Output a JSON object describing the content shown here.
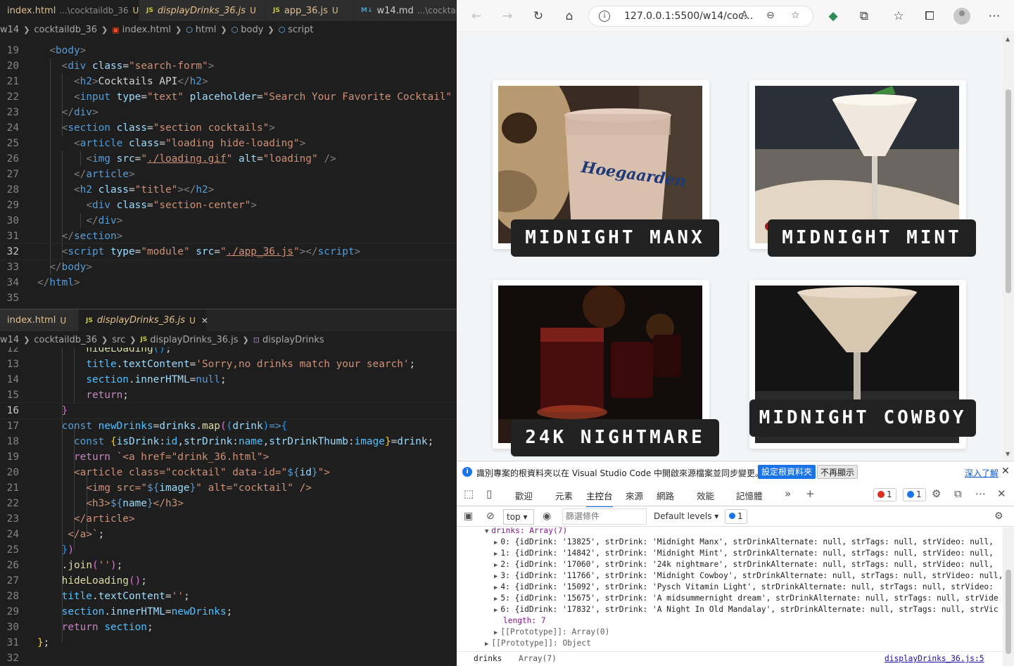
{
  "editor_top": {
    "tabs": [
      {
        "name": "index.html",
        "path": "...\\cocktaildb_36",
        "status": "U",
        "icon": "html-file-icon",
        "active": true
      },
      {
        "name": "displayDrinks_36.js",
        "path": "",
        "status": "U",
        "icon": "js-file-icon",
        "active": false
      },
      {
        "name": "app_36.js",
        "path": "",
        "status": "U",
        "icon": "js-file-icon",
        "active": false
      },
      {
        "name": "w14.md",
        "path": "...\\cocktailc",
        "status": "",
        "icon": "markdown-file-icon",
        "active": false
      }
    ],
    "breadcrumb": [
      "w14",
      "cocktaildb_36",
      "index.html",
      "html",
      "body",
      "script"
    ]
  },
  "editor_bottom": {
    "tabs": [
      {
        "name": "index.html",
        "path": "",
        "status": "U",
        "icon": "html-file-icon",
        "active": false
      },
      {
        "name": "displayDrinks_36.js",
        "path": "",
        "status": "U",
        "icon": "js-file-icon",
        "active": true
      }
    ],
    "breadcrumb": [
      "w14",
      "cocktaildb_36",
      "src",
      "displayDrinks_36.js",
      "displayDrinks"
    ]
  },
  "browser": {
    "url": "127.0.0.1:5500/w14/coc...",
    "cards": [
      {
        "name": "MIDNIGHT MANX"
      },
      {
        "name": "MIDNIGHT MINT"
      },
      {
        "name": "24K NIGHTMARE"
      },
      {
        "name": "MIDNIGHT COWBOY"
      }
    ],
    "image_text": "Hoegaarden"
  },
  "notification": {
    "text": "識別專案的根資料夾以在 Visual Studio Code 中開啟來源檔案並同步變更。",
    "primary_button": "設定根資料夾",
    "secondary_button": "不再顯示",
    "link": "深入了解"
  },
  "devtools": {
    "tabs": [
      "歡迎",
      "元素",
      "主控台",
      "來源",
      "網路",
      "效能",
      "記憶體"
    ],
    "active_tab": "主控台",
    "errors": "1",
    "messages": "1",
    "context": "top",
    "filter_placeholder": "篩選條件",
    "levels": "Default levels",
    "issues": "1",
    "console_lines": [
      "drinks: Array(7)",
      "0: {idDrink: '13825', strDrink: 'Midnight Manx', strDrinkAlternate: null, strTags: null, strVideo: null,",
      "1: {idDrink: '14842', strDrink: 'Midnight Mint', strDrinkAlternate: null, strTags: null, strVideo: null,",
      "2: {idDrink: '17060', strDrink: '24k nightmare', strDrinkAlternate: null, strTags: null, strVideo: null,",
      "3: {idDrink: '11766', strDrink: 'Midnight Cowboy', strDrinkAlternate: null, strTags: null, strVideo: null,",
      "4: {idDrink: '15092', strDrink: 'Pysch Vitamin Light', strDrinkAlternate: null, strTags: null, strVideo:",
      "5: {idDrink: '15675', strDrink: 'A midsummernight dream', strDrinkAlternate: null, strTags: null, strVide",
      "6: {idDrink: '17832', strDrink: 'A Night In Old Mandalay', strDrinkAlternate: null, strTags: null, strVic",
      "length: 7",
      "[[Prototype]]: Array(0)",
      "[[Prototype]]: Object"
    ],
    "footer_label": "drinks",
    "footer_value": "Array(7)",
    "footer_link": "displayDrinks_36.js:5"
  },
  "colors": {
    "editor_bg": "#1e1e1e",
    "untracked": "#e2c08d",
    "accent": "#1a73e8",
    "card_label_bg": "#222222"
  }
}
